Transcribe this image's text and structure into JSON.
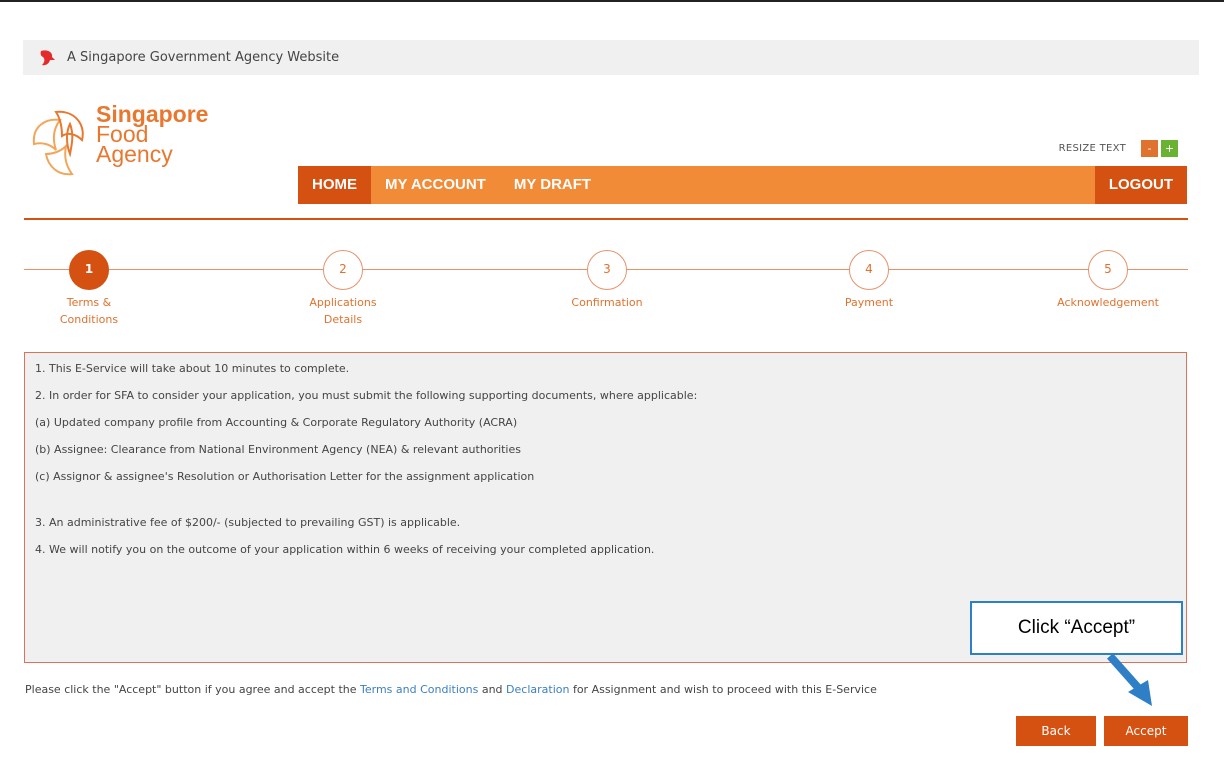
{
  "gov_banner": {
    "text": "A Singapore Government Agency Website"
  },
  "logo": {
    "line1": "Singapore",
    "line2": "Food",
    "line3": "Agency"
  },
  "resize": {
    "label": "RESIZE TEXT",
    "minus": "-",
    "plus": "+"
  },
  "nav": {
    "home": "HOME",
    "my_account": "MY ACCOUNT",
    "my_draft": "MY DRAFT",
    "logout": "LOGOUT"
  },
  "steps": [
    {
      "num": "1",
      "label_line1": "Terms &",
      "label_line2": "Conditions"
    },
    {
      "num": "2",
      "label_line1": "Applications",
      "label_line2": "Details"
    },
    {
      "num": "3",
      "label_line1": "Confirmation",
      "label_line2": ""
    },
    {
      "num": "4",
      "label_line1": "Payment",
      "label_line2": ""
    },
    {
      "num": "5",
      "label_line1": "Acknowledgement",
      "label_line2": ""
    }
  ],
  "terms": [
    "1. This E-Service will take about 10 minutes to complete.",
    "2. In order for SFA to consider your application, you must submit the following supporting documents, where applicable:",
    "(a) Updated company profile from Accounting & Corporate Regulatory Authority (ACRA)",
    "(b) Assignee: Clearance from National Environment Agency (NEA) & relevant authorities",
    "(c) Assignor & assignee's Resolution or Authorisation Letter for the assignment application",
    "3. An administrative fee of $200/- (subjected to prevailing GST) is applicable.",
    "4. We will notify you on the outcome of your application within 6 weeks of receiving your completed application."
  ],
  "note": {
    "before": "Please click the \"Accept\" button if you agree and accept the ",
    "link1": "Terms and Conditions",
    "middle": " and ",
    "link2": "Declaration",
    "after": " for Assignment and wish to proceed with this E-Service"
  },
  "buttons": {
    "back": "Back",
    "accept": "Accept"
  },
  "callout": {
    "text": "Click “Accept”"
  },
  "colors": {
    "primary": "#d55112",
    "nav_bg": "#f28b37",
    "link": "#3c7fc1",
    "callout_border": "#2f7fc6"
  }
}
